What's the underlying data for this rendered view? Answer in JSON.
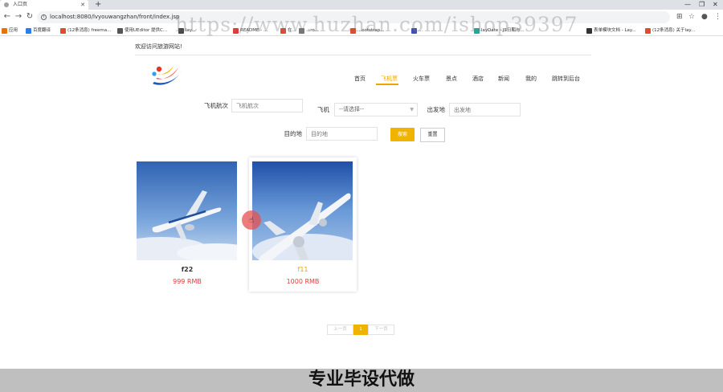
{
  "browser": {
    "tab_title": "入口页",
    "url": "localhost:8080/lvyouwangzhan/front/index.jsp",
    "bookmarks": [
      {
        "label": "应用",
        "color": "#e8710a"
      },
      {
        "label": "百度翻译",
        "color": "#2b7de9"
      },
      {
        "label": "(12条消息) freema...",
        "color": "#e24b2b"
      },
      {
        "label": "使用UEditor 提供C...",
        "color": "#555555"
      },
      {
        "label": "lay...",
        "color": "#4a4a4a"
      },
      {
        "label": "README - ...",
        "color": "#e53935"
      },
      {
        "label": "在...",
        "color": "#e24b2b"
      },
      {
        "label": "...ro...",
        "color": "#777777"
      },
      {
        "label": "...ootstrap...",
        "color": "#e24b2b"
      },
      {
        "label": "...",
        "color": "#3f51b5"
      },
      {
        "label": "layDate - JS日期与...",
        "color": "#26a69a"
      },
      {
        "label": "表单模块文档 - Lay...",
        "color": "#333333"
      },
      {
        "label": "(12条消息) 关于lay...",
        "color": "#e24b2b"
      }
    ]
  },
  "watermark": "https://www.huzhan.com/ishop39397",
  "header": {
    "welcome": "欢迎访问旅游网站!"
  },
  "nav": {
    "items": [
      "首页",
      "飞机票",
      "火车票",
      "景点",
      "酒店",
      "新闻",
      "我的",
      "跳转到后台"
    ],
    "active_index": 1
  },
  "search": {
    "flight_no_label": "飞机航次",
    "flight_no_placeholder": "飞机航次",
    "plane_label": "飞机",
    "plane_select_value": "--请选择--",
    "departure_label": "出发地",
    "departure_placeholder": "出发地",
    "destination_label": "目的地",
    "destination_placeholder": "目的地",
    "search_button": "搜索",
    "reset_button": "重置"
  },
  "products": [
    {
      "name": "f22",
      "price": "999 RMB"
    },
    {
      "name": "f11",
      "price": "1000 RMB"
    }
  ],
  "pagination": {
    "prev": "上一页",
    "current": "1",
    "next": "下一页"
  },
  "banner": "专业毕设代做",
  "colors": {
    "accent": "#f0b400",
    "price": "#e03c3c",
    "sky": "#3d6fb6"
  }
}
